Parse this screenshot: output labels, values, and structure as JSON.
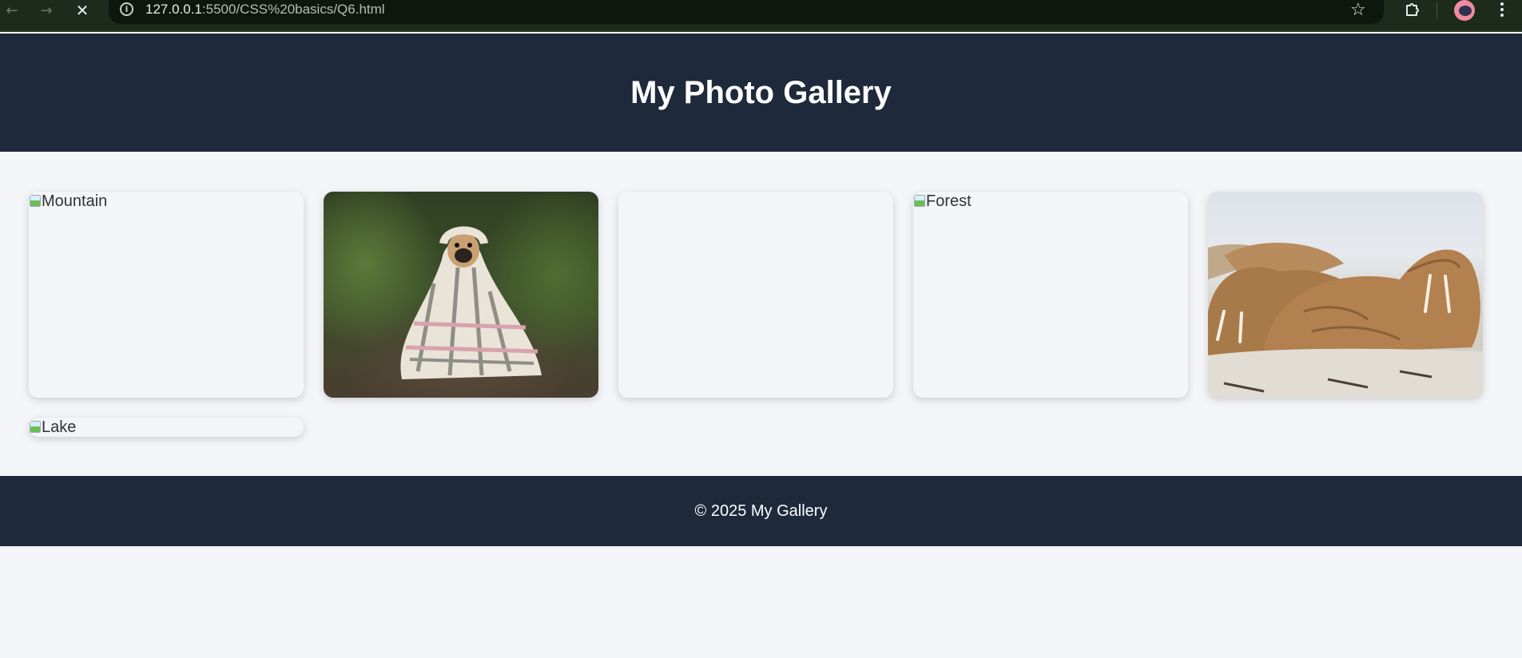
{
  "browser": {
    "url_host": "127.0.0.1",
    "url_rest": ":5500/CSS%20basics/Q6.html",
    "back_icon": "←",
    "forward_icon": "→",
    "stop_icon": "✕",
    "info_icon": "i",
    "star_icon": "☆"
  },
  "header": {
    "title": "My Photo Gallery"
  },
  "gallery": {
    "items": [
      {
        "alt": "Mountain",
        "loaded": false
      },
      {
        "alt": "",
        "loaded": true,
        "subject": "pug-in-blanket"
      },
      {
        "alt": "",
        "loaded": false
      },
      {
        "alt": "Forest",
        "loaded": false
      },
      {
        "alt": "",
        "loaded": true,
        "subject": "walruses"
      },
      {
        "alt": "Lake",
        "loaded": false
      }
    ]
  },
  "footer": {
    "text": "© 2025 My Gallery"
  },
  "colors": {
    "header_bg": "#1e293b",
    "footer_bg": "#1e293b",
    "page_bg": "#f3f5f8"
  }
}
